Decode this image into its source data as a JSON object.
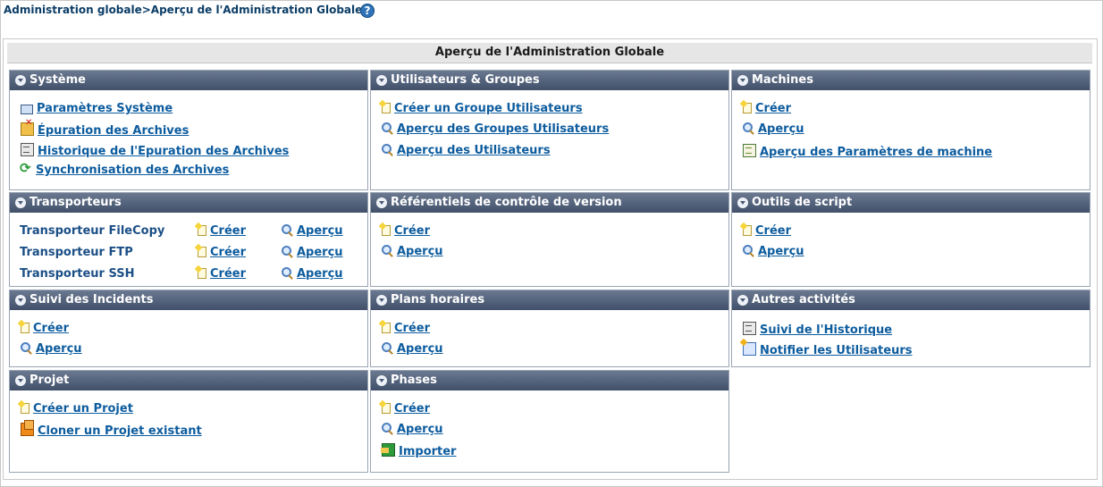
{
  "breadcrumb": {
    "path": "Administration globale>Aperçu de l'Administration Globale",
    "help": "?"
  },
  "page_title": "Aperçu de l'Administration Globale",
  "colors": {
    "link": "#0d5c9e",
    "header_top": "#6a7890",
    "header_bottom": "#41506a",
    "label": "#1b4f86"
  },
  "panels": {
    "systeme": {
      "title": "Système",
      "links": [
        "Paramètres Système",
        "Épuration des Archives",
        "Historique de l'Epuration des Archives",
        "Synchronisation des Archives"
      ]
    },
    "utilisateurs": {
      "title": "Utilisateurs & Groupes",
      "links": [
        "Créer un Groupe Utilisateurs",
        "Aperçu des Groupes Utilisateurs",
        "Aperçu des Utilisateurs"
      ]
    },
    "machines": {
      "title": "Machines",
      "links": [
        "Créer",
        "Aperçu",
        "Aperçu des Paramètres de machine"
      ]
    },
    "transporteurs": {
      "title": "Transporteurs",
      "rows": [
        {
          "label": "Transporteur FileCopy",
          "create": "Créer",
          "view": "Aperçu"
        },
        {
          "label": "Transporteur FTP",
          "create": "Créer",
          "view": "Aperçu"
        },
        {
          "label": "Transporteur SSH",
          "create": "Créer",
          "view": "Aperçu"
        }
      ]
    },
    "referentiels": {
      "title": "Référentiels de contrôle de version",
      "links": [
        "Créer",
        "Aperçu"
      ]
    },
    "outils": {
      "title": "Outils de script",
      "links": [
        "Créer",
        "Aperçu"
      ]
    },
    "incidents": {
      "title": "Suivi des Incidents",
      "links": [
        "Créer",
        "Aperçu"
      ]
    },
    "plans": {
      "title": "Plans horaires",
      "links": [
        "Créer",
        "Aperçu"
      ]
    },
    "autres": {
      "title": "Autres activités",
      "links": [
        "Suivi de l'Historique",
        "Notifier les Utilisateurs"
      ]
    },
    "projet": {
      "title": "Projet",
      "links": [
        "Créer un Projet",
        "Cloner un Projet existant"
      ]
    },
    "phases": {
      "title": "Phases",
      "links": [
        "Créer",
        "Aperçu",
        "Importer"
      ]
    }
  }
}
